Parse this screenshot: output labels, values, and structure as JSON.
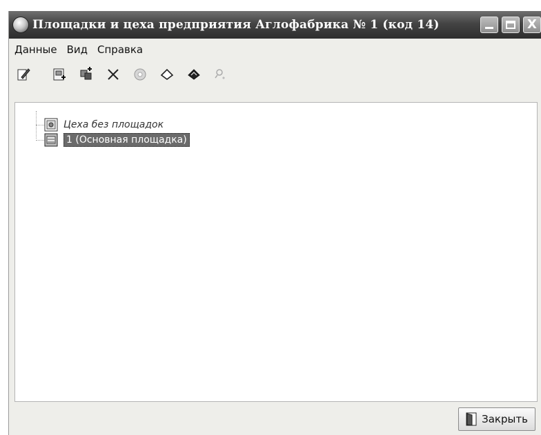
{
  "window": {
    "title": "Площадки и цеха предприятия Аглофабрика № 1 (код 14)",
    "controls": {
      "close_glyph": "X"
    }
  },
  "menu": [
    "Данные",
    "Вид",
    "Справка"
  ],
  "toolbar": {
    "buttons": [
      "edit-icon",
      "add-item-icon",
      "add-group-icon",
      "delete-icon",
      "disc-icon",
      "eraser-outline-icon",
      "eraser-filled-icon",
      "find-icon"
    ]
  },
  "tree": {
    "nodes": [
      {
        "label": "Цеха без площадок",
        "icon": "plant-icon",
        "italic": true
      },
      {
        "label": "1 (Основная площадка)",
        "icon": "site-icon",
        "selected": true
      }
    ]
  },
  "footer": {
    "close_label": "Закрыть"
  }
}
